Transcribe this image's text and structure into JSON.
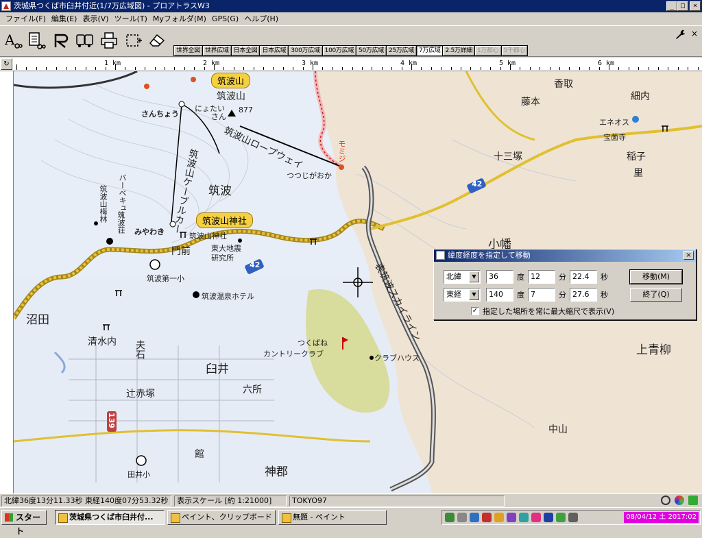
{
  "window": {
    "title": "茨城県つくば市臼井付近(1/7万広域図) - プロアトラスW3",
    "min": "_",
    "max": "□",
    "close": "×"
  },
  "menu": [
    "ファイル(F)",
    "編集(E)",
    "表示(V)",
    "ツール(T)",
    "Myフォルダ(M)",
    "GPS(G)",
    "ヘルプ(H)"
  ],
  "scales": [
    {
      "label": "世界全図",
      "state": "normal"
    },
    {
      "label": "世界広域",
      "state": "normal"
    },
    {
      "label": "日本全図",
      "state": "normal"
    },
    {
      "label": "日本広域",
      "state": "normal"
    },
    {
      "label": "300万広域",
      "state": "normal"
    },
    {
      "label": "100万広域",
      "state": "normal"
    },
    {
      "label": "50万広域",
      "state": "normal"
    },
    {
      "label": "25万広域",
      "state": "normal"
    },
    {
      "label": "7万広域",
      "state": "active"
    },
    {
      "label": "2.5万詳細",
      "state": "normal"
    },
    {
      "label": "1万都心",
      "state": "disabled"
    },
    {
      "label": "5千都心",
      "state": "disabled"
    }
  ],
  "ruler": {
    "labels": [
      "1 km",
      "2 km",
      "3 km",
      "4 km",
      "5 km",
      "6 km"
    ]
  },
  "map": {
    "labels": {
      "tsukubasan_tag": "筑波山",
      "tsukubasan": "筑波山",
      "nyotaisan": "にょたい",
      "san": "さん",
      "elev": "877",
      "sanchou": "さんちょう",
      "ropeway": "筑波山ロープウェイ",
      "momiji": "モミジ",
      "tsutsujigaoka": "つつじがおか",
      "cable": "筑波山ケーブルカー",
      "tsukuba": "筑波",
      "bbq": "バーベキュー",
      "baien": "筑波山梅林",
      "tsukubaso": "筑波荘",
      "miyawaki": "みやわき",
      "jinja_tag": "筑波山神社",
      "jinja": "筑波山神社",
      "todai": "東大地震",
      "kenkyujo": "研究所",
      "monzen": "門前",
      "daiichi": "筑波第一小",
      "onsen": "筑波温泉ホテル",
      "numata": "沼田",
      "shimizu": "清水内",
      "fuseki": "夫石",
      "usui": "臼井",
      "tsujiakatsuka": "辻赤塚",
      "rokusho": "六所",
      "yakata": "館",
      "kamigori": "神郡",
      "taikosho": "田井小",
      "country1": "つくばね",
      "country2": "カントリークラブ",
      "clubhouse": "クラブハウス",
      "skyline": "表筑波スカイライン",
      "kotori": "香取",
      "fujimoto": "藤本",
      "hosouchi": "細内",
      "eneos": "エネオス",
      "hoenji": "宝薗寺",
      "jusanzuka": "十三塚",
      "inako": "稲子",
      "sato": "里",
      "obata": "小幡",
      "kamiaoyagi": "上青柳",
      "nakayama": "中山",
      "route42a": "42",
      "route42b": "42",
      "route139": "139"
    }
  },
  "dialog": {
    "title": "緯度経度を指定して移動",
    "close": "×",
    "lat_hemi": "北緯",
    "lat_deg": "36",
    "lat_min": "12",
    "lat_sec": "22.4",
    "lon_hemi": "東経",
    "lon_deg": "140",
    "lon_min": "7",
    "lon_sec": "27.6",
    "deg": "度",
    "min": "分",
    "sec": "秒",
    "move_btn": "移動(M)",
    "end_btn": "終了(Q)",
    "check_label": "指定した場所を常に最大縮尺で表示(V)",
    "check_mark": "✓",
    "arrow": "▼"
  },
  "status": {
    "coords": "北緯36度13分11.33秒 東経140度07分53.32秒",
    "scale": "表示スケール [約 1:21000]",
    "datum": "TOKYO97"
  },
  "taskbar": {
    "start": "スタート",
    "tasks": [
      "茨城県つくば市臼井付...",
      "ペイント、クリップボード",
      "無題 - ペイント"
    ],
    "clock": "08/04/12 土 2017:02"
  }
}
